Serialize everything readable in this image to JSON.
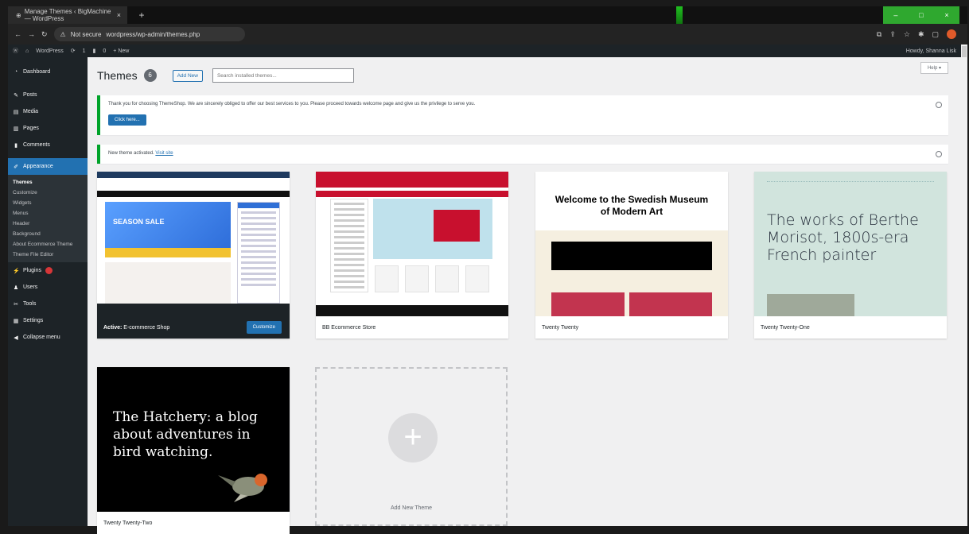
{
  "browser": {
    "tab_title": "Manage Themes ‹ BigMachine — WordPress",
    "tab_close": "×",
    "new_tab": "+",
    "url_security": "Not secure",
    "url": "wordpress/wp-admin/themes.php",
    "window_controls": [
      "–",
      "□",
      "×"
    ]
  },
  "adminbar": {
    "site_name": "WordPress",
    "updates_count": "1",
    "comments_count": "0",
    "new_label": "+ New",
    "howdy": "Howdy, Shanna Lisk"
  },
  "sidebar": {
    "items": [
      {
        "label": "Dashboard",
        "icon": "dashboard-icon"
      },
      {
        "label": "Posts",
        "icon": "pin-icon"
      },
      {
        "label": "Media",
        "icon": "media-icon"
      },
      {
        "label": "Pages",
        "icon": "page-icon"
      },
      {
        "label": "Comments",
        "icon": "comment-icon"
      }
    ],
    "appearance": {
      "label": "Appearance",
      "icon": "brush-icon"
    },
    "appearance_sub": [
      "Themes",
      "Customize",
      "Widgets",
      "Menus",
      "Header",
      "Background",
      "About Ecommerce Theme",
      "Theme File Editor"
    ],
    "items_after": [
      {
        "label": "Plugins",
        "icon": "plugin-icon"
      },
      {
        "label": "Users",
        "icon": "user-icon"
      },
      {
        "label": "Tools",
        "icon": "tools-icon"
      },
      {
        "label": "Settings",
        "icon": "settings-icon"
      },
      {
        "label": "Collapse menu",
        "icon": "collapse-icon"
      }
    ]
  },
  "header": {
    "title": "Themes",
    "count": "6",
    "add_new": "Add New",
    "search_placeholder": "Search installed themes...",
    "help": "Help ▾"
  },
  "notices": {
    "promo_text": "Thank you for choosing ThemeShop. We are sincerely obliged to offer our best services to you. Please proceed towards welcome page and give us the privilege to serve you.",
    "promo_button": "Click here...",
    "activated_text": "New theme activated.",
    "visit_site": "Visit site"
  },
  "themes": [
    {
      "name": "E-commerce Shop",
      "active_prefix": "Active:",
      "customize": "Customize",
      "thumb_text": "SEASON SALE"
    },
    {
      "name": "BB Ecommerce Store"
    },
    {
      "name": "Twenty Twenty",
      "thumb_text": "Welcome to the Swedish Museum of Modern Art"
    },
    {
      "name": "Twenty Twenty-One",
      "thumb_text": "The works of Berthe Morisot, 1800s-era French painter"
    },
    {
      "name": "Twenty Twenty-Two",
      "thumb_text": "The Hatchery: a blog about adventures in bird watching."
    }
  ],
  "add_new_theme": {
    "label": "Add New Theme",
    "plus": "+"
  },
  "colors": {
    "wp_blue": "#2271b1",
    "admin_dark": "#1d2327",
    "notice_green": "#00a32a",
    "bb_red": "#c8102e",
    "tto_green": "#d1e4dd"
  }
}
